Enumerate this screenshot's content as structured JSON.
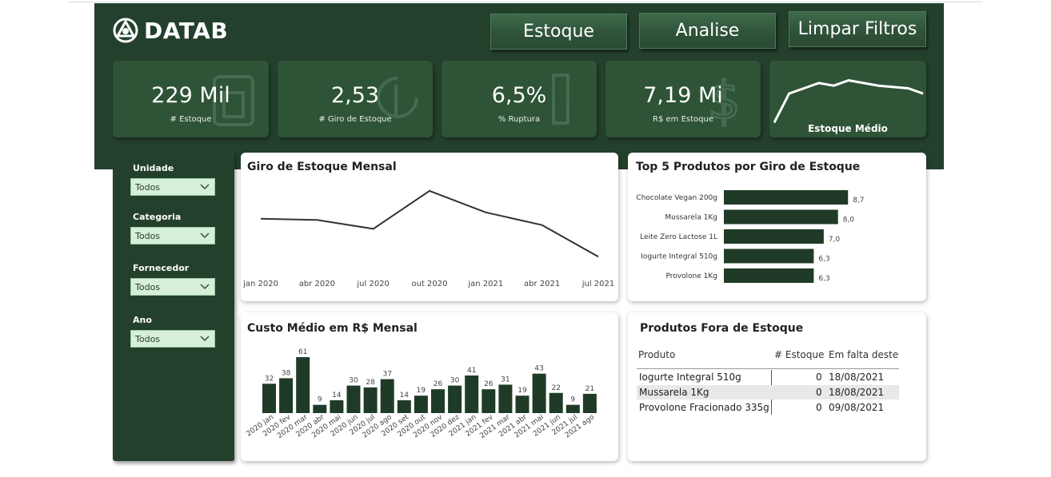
{
  "app": {
    "logo_text": "DATAB"
  },
  "nav": {
    "estoque": "Estoque",
    "analise": "Analise",
    "limpar": "Limpar Filtros"
  },
  "kpis": [
    {
      "value": "229 Mil",
      "label": "# Estoque",
      "icon": "box-icon"
    },
    {
      "value": "2,53",
      "label": "# Giro de Estoque",
      "icon": "refresh-icon"
    },
    {
      "value": "6,5%",
      "label": "% Ruptura",
      "icon": "alert-icon"
    },
    {
      "value": "7,19 Mi",
      "label": "R$ em Estoque",
      "icon": "dollar-icon"
    }
  ],
  "kpi_spark": {
    "label": "Estoque Médio",
    "values": [
      2,
      13,
      15,
      17,
      16,
      18,
      17,
      16,
      15.5,
      15,
      13
    ]
  },
  "filters": {
    "unidade": {
      "label": "Unidade",
      "value": "Todos"
    },
    "categoria": {
      "label": "Categoria",
      "value": "Todos"
    },
    "fornecedor": {
      "label": "Fornecedor",
      "value": "Todos"
    },
    "ano": {
      "label": "Ano",
      "value": "Todos"
    }
  },
  "giro": {
    "title": "Giro de Estoque Mensal"
  },
  "top5": {
    "title": "Top 5 Produtos por Giro de Estoque"
  },
  "custo": {
    "title": "Custo Médio em R$ Mensal"
  },
  "fora": {
    "title": "Produtos Fora de Estoque",
    "headers": [
      "Produto",
      "# Estoque",
      "Em falta deste"
    ],
    "rows": [
      {
        "produto": "Iogurte Integral 510g",
        "estoque": "0",
        "data": "18/08/2021"
      },
      {
        "produto": "Mussarela 1Kg",
        "estoque": "0",
        "data": "18/08/2021"
      },
      {
        "produto": "Provolone Fracionado 335g",
        "estoque": "0",
        "data": "09/08/2021"
      }
    ]
  },
  "chart_data": [
    {
      "type": "line",
      "title": "Giro de Estoque Mensal",
      "x": [
        "jan 2020",
        "abr 2020",
        "jul 2020",
        "out 2020",
        "jan 2021",
        "abr 2021",
        "jul 2021"
      ],
      "values": [
        0.23,
        0.22,
        0.15,
        0.45,
        0.28,
        0.18,
        -0.07
      ],
      "ylim": [
        -0.1,
        0.5
      ]
    },
    {
      "type": "bar",
      "orientation": "horizontal",
      "title": "Top 5 Produtos por Giro de Estoque",
      "categories": [
        "Chocolate Vegan 200g",
        "Mussarela 1Kg",
        "Leite Zero Lactose 1L",
        "Iogurte Integral 510g",
        "Provolone 1Kg"
      ],
      "values": [
        8.7,
        8.0,
        7.0,
        6.3,
        6.3
      ],
      "labels": [
        "8,7",
        "8,0",
        "7,0",
        "6,3",
        "6,3"
      ],
      "xlim": [
        0,
        9
      ]
    },
    {
      "type": "bar",
      "title": "Custo Médio em R$ Mensal",
      "categories": [
        "2020 jan",
        "2020 fev",
        "2020 mar",
        "2020 abr",
        "2020 mai",
        "2020 jun",
        "2020 jul",
        "2020 ago",
        "2020 set",
        "2020 out",
        "2020 nov",
        "2020 dez",
        "2021 jan",
        "2021 fev",
        "2021 mar",
        "2021 abr",
        "2021 mai",
        "2021 jun",
        "2021 jul",
        "2021 ago"
      ],
      "values": [
        32,
        38,
        61,
        9,
        14,
        30,
        28,
        37,
        14,
        19,
        26,
        30,
        41,
        26,
        31,
        19,
        43,
        22,
        9,
        21
      ],
      "ylim": [
        0,
        65
      ]
    }
  ],
  "colors": {
    "primary": "#23402c",
    "kpi": "#2e5337",
    "bar": "#1f3b27",
    "filter_bg": "#d6efd9"
  }
}
